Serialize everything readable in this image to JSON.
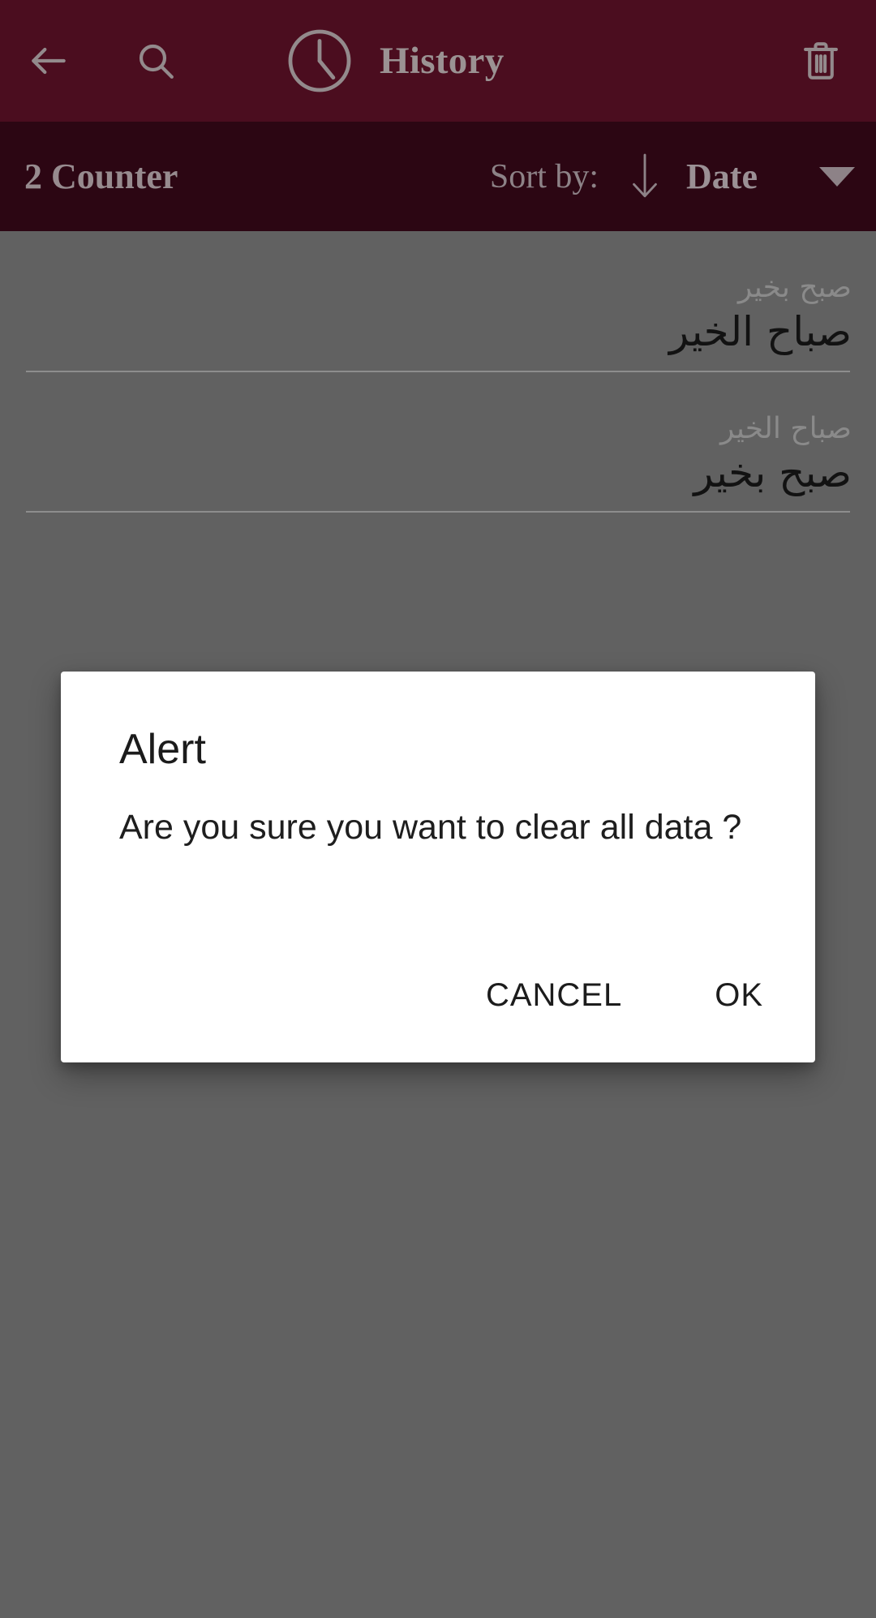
{
  "appbar": {
    "background": "#4b0d1f",
    "title": "History",
    "icons": {
      "back": "arrow-left-icon",
      "search": "search-icon",
      "clock": "clock-icon",
      "delete": "trash-icon"
    }
  },
  "subbar": {
    "background": "#2c0613",
    "counter": "2 Counter",
    "sort_by_label": "Sort by:",
    "sort_direction": "descending",
    "sort_field": "Date",
    "caret": "chevron-down-icon"
  },
  "list": {
    "items": [
      {
        "source": "صبح بخير",
        "target": "صباح الخير"
      },
      {
        "source": "صباح الخير",
        "target": "صبح بخير"
      }
    ]
  },
  "dialog": {
    "title": "Alert",
    "message": "Are you sure you want to clear all data ?",
    "cancel_label": "CANCEL",
    "ok_label": "OK",
    "background": "#ffffff"
  },
  "scrim": {
    "color": "#616161"
  }
}
